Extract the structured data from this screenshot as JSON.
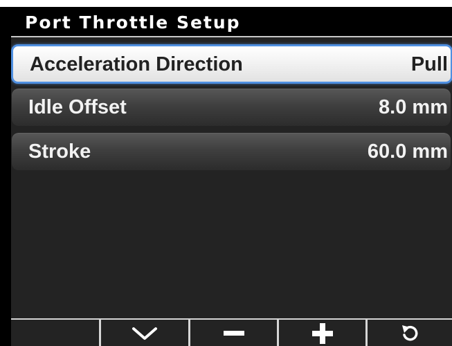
{
  "header": {
    "title": "Port Throttle Setup"
  },
  "settings": [
    {
      "label": "Acceleration Direction",
      "value": "Pull",
      "selected": true
    },
    {
      "label": "Idle Offset",
      "value": "8.0 mm",
      "selected": false
    },
    {
      "label": "Stroke",
      "value": "60.0 mm",
      "selected": false
    }
  ],
  "softkeys": [
    {
      "icon": "blank"
    },
    {
      "icon": "chevron-down-icon"
    },
    {
      "icon": "minus-icon"
    },
    {
      "icon": "plus-icon"
    },
    {
      "icon": "undo-icon"
    }
  ],
  "colors": {
    "selection_border": "#4f8fe0",
    "background": "#232323",
    "title_bar": "#000000"
  }
}
